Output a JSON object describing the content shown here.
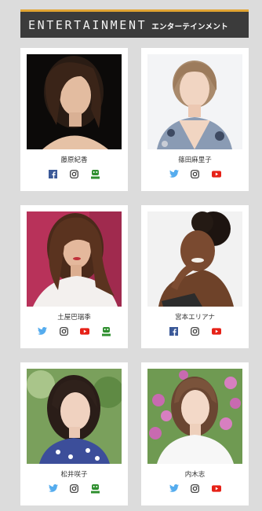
{
  "header": {
    "title_en": "ENTERTAINMENT",
    "title_ja": "エンターテインメント"
  },
  "colors": {
    "accent": "#e1a432",
    "header_bg": "#3b3b3b",
    "facebook": "#3b5998",
    "twitter": "#55acee",
    "youtube": "#e62117",
    "blog": "#2f8f2f"
  },
  "talents": [
    {
      "name": "藤原紀香",
      "social": [
        "facebook-icon",
        "instagram-icon",
        "blog-icon"
      ]
    },
    {
      "name": "篠田麻里子",
      "social": [
        "twitter-icon",
        "instagram-icon",
        "youtube-icon"
      ]
    },
    {
      "name": "土屋巴瑞季",
      "social": [
        "twitter-icon",
        "instagram-icon",
        "youtube-icon",
        "blog-icon"
      ]
    },
    {
      "name": "宮本エリアナ",
      "social": [
        "facebook-icon",
        "instagram-icon",
        "youtube-icon"
      ]
    },
    {
      "name": "松井咲子",
      "social": [
        "twitter-icon",
        "instagram-icon",
        "blog-icon"
      ]
    },
    {
      "name": "内木志",
      "social": [
        "twitter-icon",
        "instagram-icon",
        "youtube-icon"
      ]
    }
  ]
}
